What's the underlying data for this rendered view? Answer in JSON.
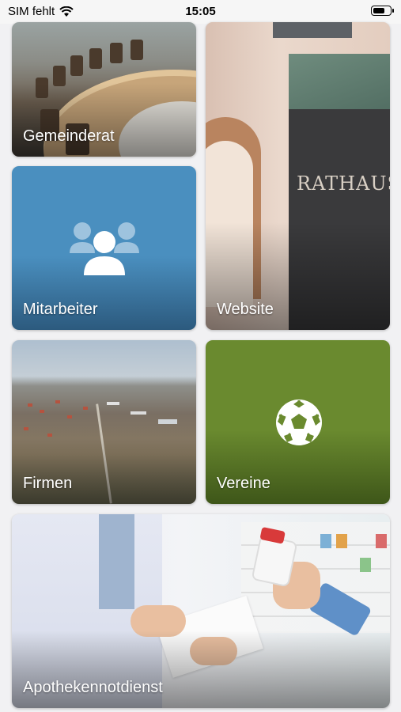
{
  "status_bar": {
    "carrier": "SIM fehlt",
    "time": "15:05"
  },
  "tiles": {
    "gemeinderat": "Gemeinderat",
    "website": "Website",
    "website_sign": "RATHAUS",
    "mitarbeiter": "Mitarbeiter",
    "firmen": "Firmen",
    "vereine": "Vereine",
    "apotheke": "Apothekennotdienst"
  },
  "icons": {
    "mitarbeiter": "people-group-icon",
    "vereine": "soccer-ball-icon"
  },
  "colors": {
    "mitarbeiter_bg": "#4a8fbf",
    "vereine_bg": "#6a8a2f",
    "page_bg": "#f1f1f3"
  }
}
